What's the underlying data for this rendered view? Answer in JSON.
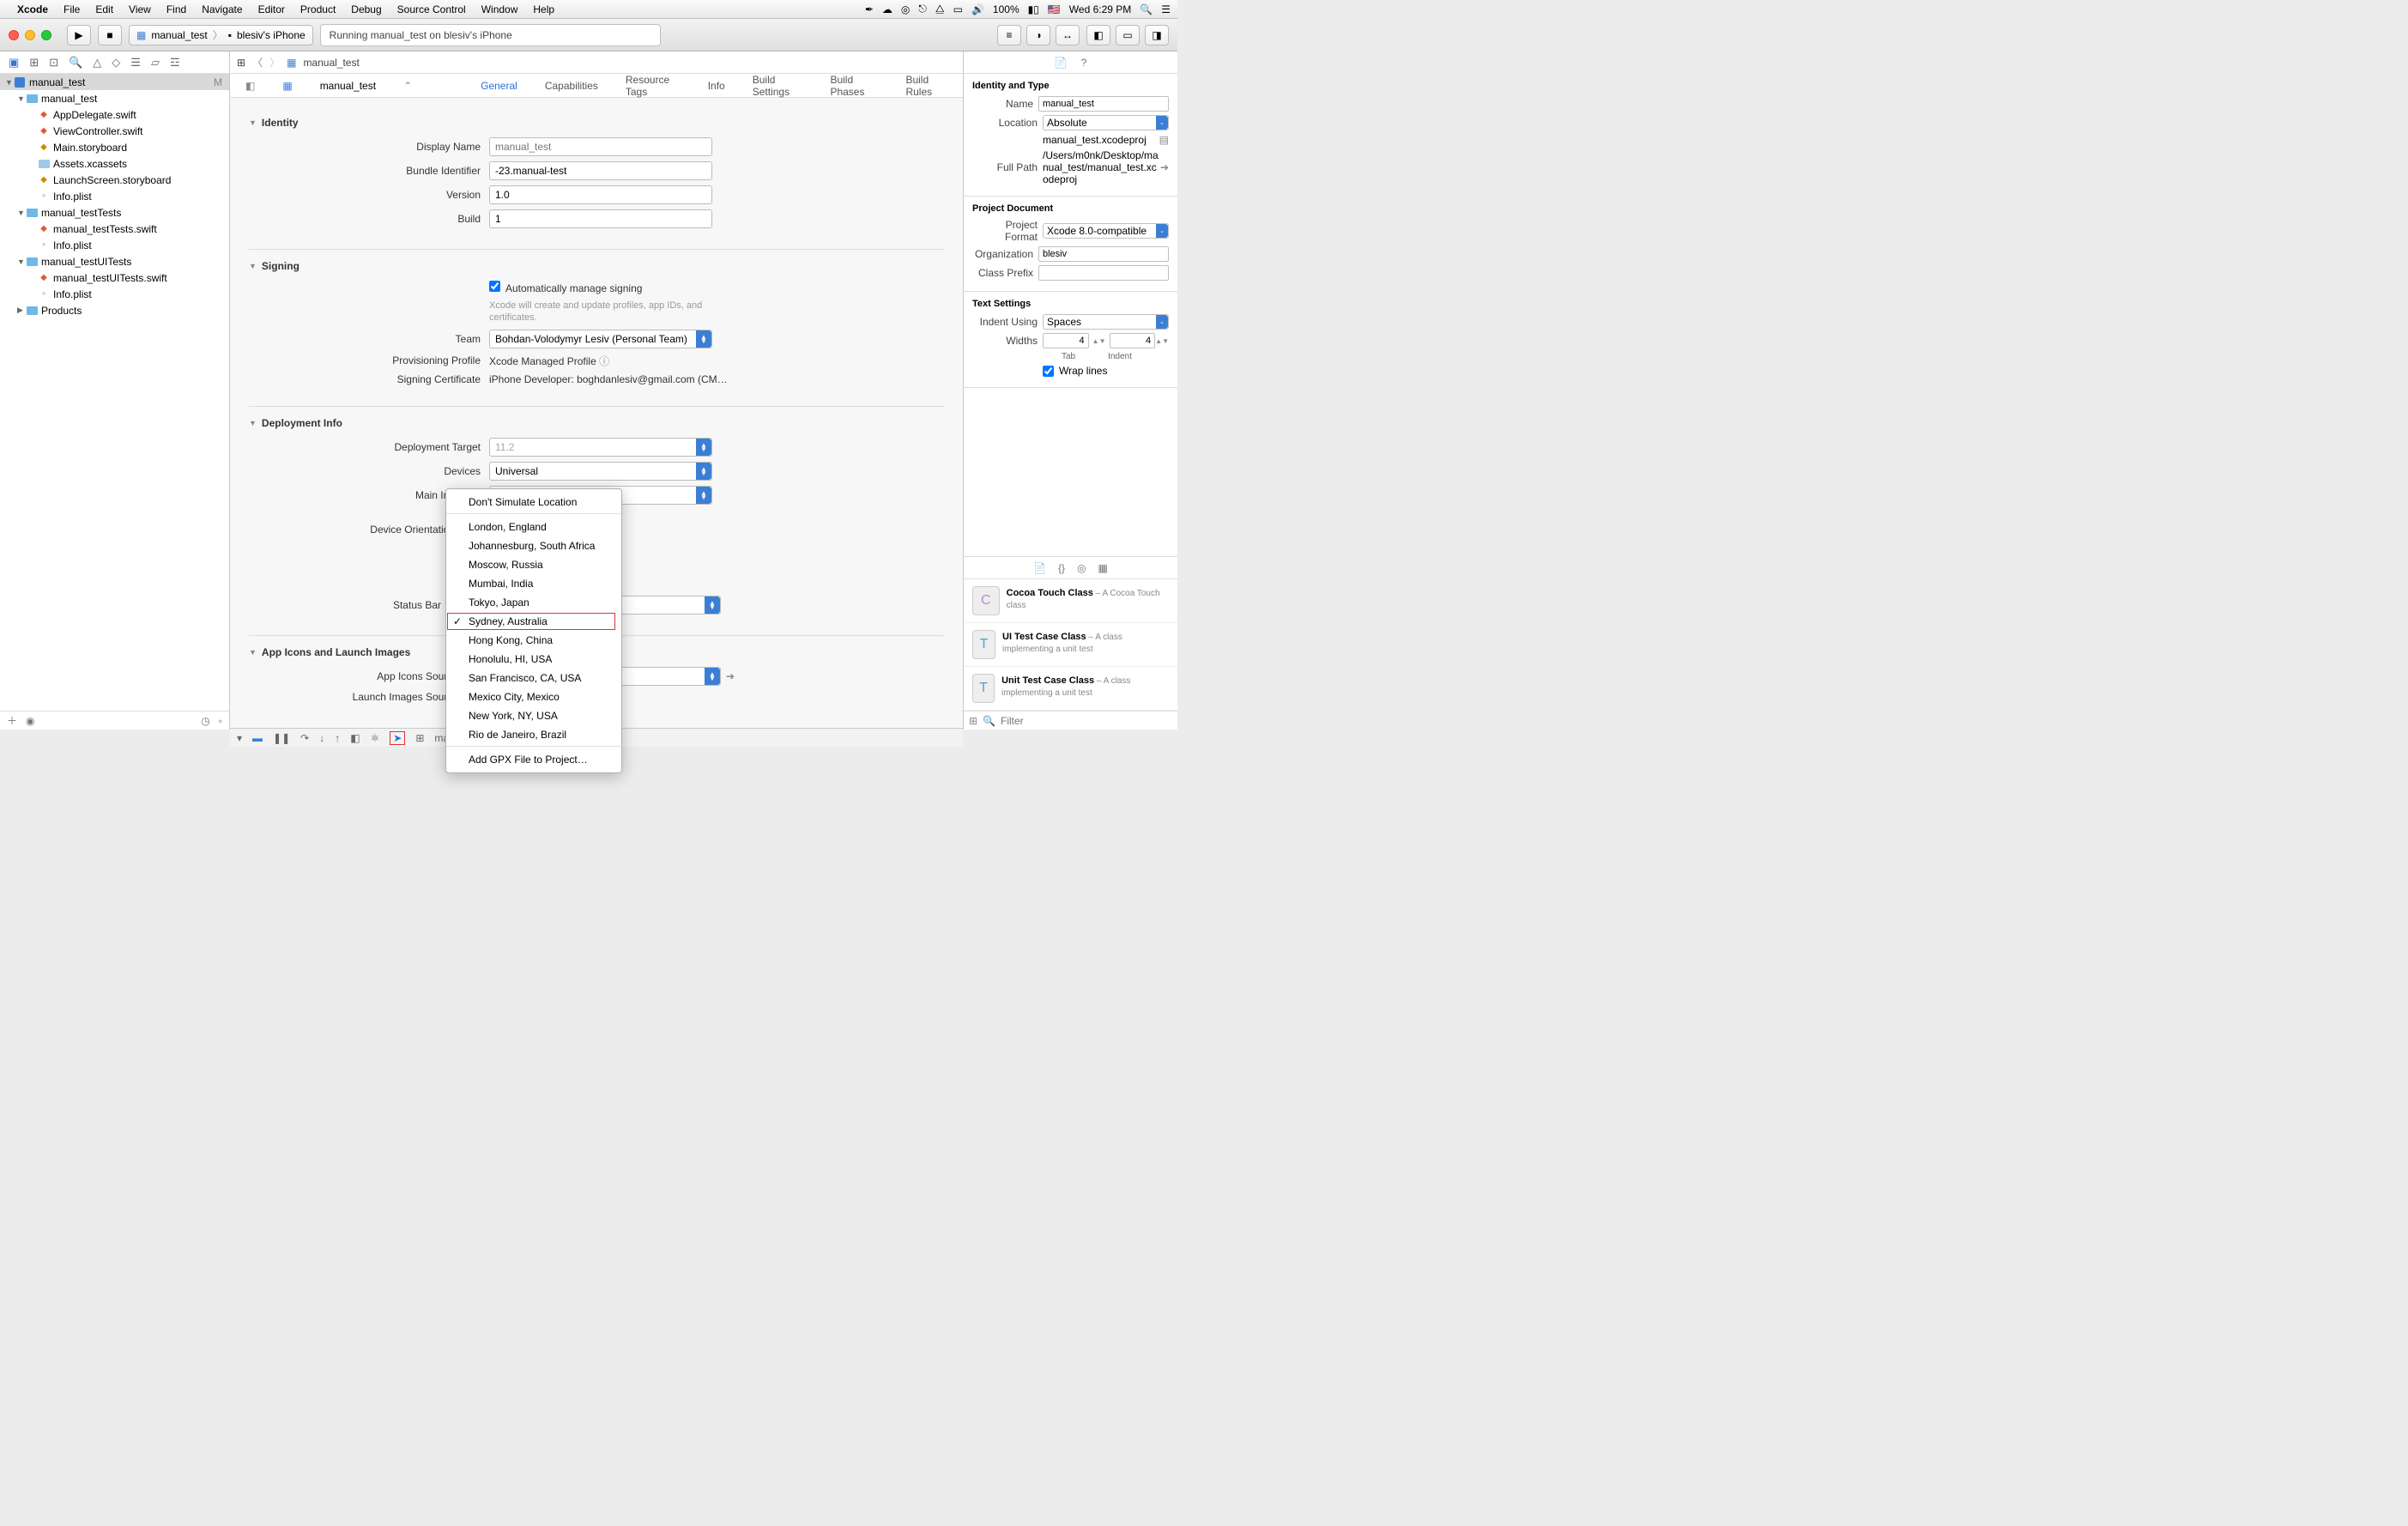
{
  "menubar": {
    "app": "Xcode",
    "items": [
      "File",
      "Edit",
      "View",
      "Find",
      "Navigate",
      "Editor",
      "Product",
      "Debug",
      "Source Control",
      "Window",
      "Help"
    ],
    "battery": "100%",
    "clock": "Wed 6:29 PM"
  },
  "toolbar": {
    "scheme": "manual_test",
    "device": "blesiv's iPhone",
    "activity": "Running manual_test on  blesiv's iPhone"
  },
  "navigator": {
    "root": "manual_test",
    "root_mod": "M",
    "g1": "manual_test",
    "g1_files": [
      "AppDelegate.swift",
      "ViewController.swift",
      "Main.storyboard",
      "Assets.xcassets",
      "LaunchScreen.storyboard",
      "Info.plist"
    ],
    "g2": "manual_testTests",
    "g2_files": [
      "manual_testTests.swift",
      "Info.plist"
    ],
    "g3": "manual_testUITests",
    "g3_files": [
      "manual_testUITests.swift",
      "Info.plist"
    ],
    "g4": "Products"
  },
  "jump": {
    "project": "manual_test",
    "file": "manual_test"
  },
  "tabs": [
    "General",
    "Capabilities",
    "Resource Tags",
    "Info",
    "Build Settings",
    "Build Phases",
    "Build Rules"
  ],
  "identity": {
    "header": "Identity",
    "display_name_label": "Display Name",
    "display_name_ph": "manual_test",
    "bundle_id_label": "Bundle Identifier",
    "bundle_id": "-23.manual-test",
    "version_label": "Version",
    "version": "1.0",
    "build_label": "Build",
    "build": "1"
  },
  "signing": {
    "header": "Signing",
    "auto_label": "Automatically manage signing",
    "auto_hint": "Xcode will create and update profiles, app IDs, and certificates.",
    "team_label": "Team",
    "team": "Bohdan-Volodymyr Lesiv (Personal Team)",
    "prov_label": "Provisioning Profile",
    "prov": "Xcode Managed Profile",
    "cert_label": "Signing Certificate",
    "cert": "iPhone Developer: boghdanlesiv@gmail.com (CM…"
  },
  "deploy": {
    "header": "Deployment Info",
    "target_label": "Deployment Target",
    "target_ph": "11.2",
    "devices_label": "Devices",
    "devices": "Universal",
    "main_if_label": "Main Interface",
    "orient_label": "Device Orientation",
    "status_label": "Status Bar"
  },
  "appicons": {
    "header": "App Icons and Launch Images",
    "icons_label": "App Icons Source",
    "launch_label": "Launch Images Source"
  },
  "location_menu": {
    "dont": "Don't Simulate Location",
    "items": [
      "London, England",
      "Johannesburg, South Africa",
      "Moscow, Russia",
      "Mumbai, India",
      "Tokyo, Japan",
      "Sydney, Australia",
      "Hong Kong, China",
      "Honolulu, HI, USA",
      "San Francisco, CA, USA",
      "Mexico City, Mexico",
      "New York, NY, USA",
      "Rio de Janeiro, Brazil"
    ],
    "selected_index": 5,
    "add": "Add GPX File to Project…"
  },
  "debugbar": {
    "process": "manual_test"
  },
  "inspector": {
    "identity_header": "Identity and Type",
    "name_label": "Name",
    "name": "manual_test",
    "location_label": "Location",
    "location": "Absolute",
    "location_file": "manual_test.xcodeproj",
    "fullpath_label": "Full Path",
    "fullpath": "/Users/m0nk/Desktop/manual_test/manual_test.xcodeproj",
    "projdoc_header": "Project Document",
    "format_label": "Project Format",
    "format": "Xcode 8.0-compatible",
    "org_label": "Organization",
    "org": "blesiv",
    "prefix_label": "Class Prefix",
    "prefix": "",
    "text_header": "Text Settings",
    "indent_label": "Indent Using",
    "indent": "Spaces",
    "widths_label": "Widths",
    "tab_w": "4",
    "indent_w": "4",
    "tab_caption": "Tab",
    "indent_caption": "Indent",
    "wrap_label": "Wrap lines"
  },
  "library": {
    "i0_t": "Cocoa Touch Class",
    "i0_d": " – A Cocoa Touch class",
    "i1_t": "UI Test Case Class",
    "i1_d": " – A class implementing a unit test",
    "i2_t": "Unit Test Case Class",
    "i2_d": " – A class implementing a unit test",
    "filter_ph": "Filter"
  }
}
